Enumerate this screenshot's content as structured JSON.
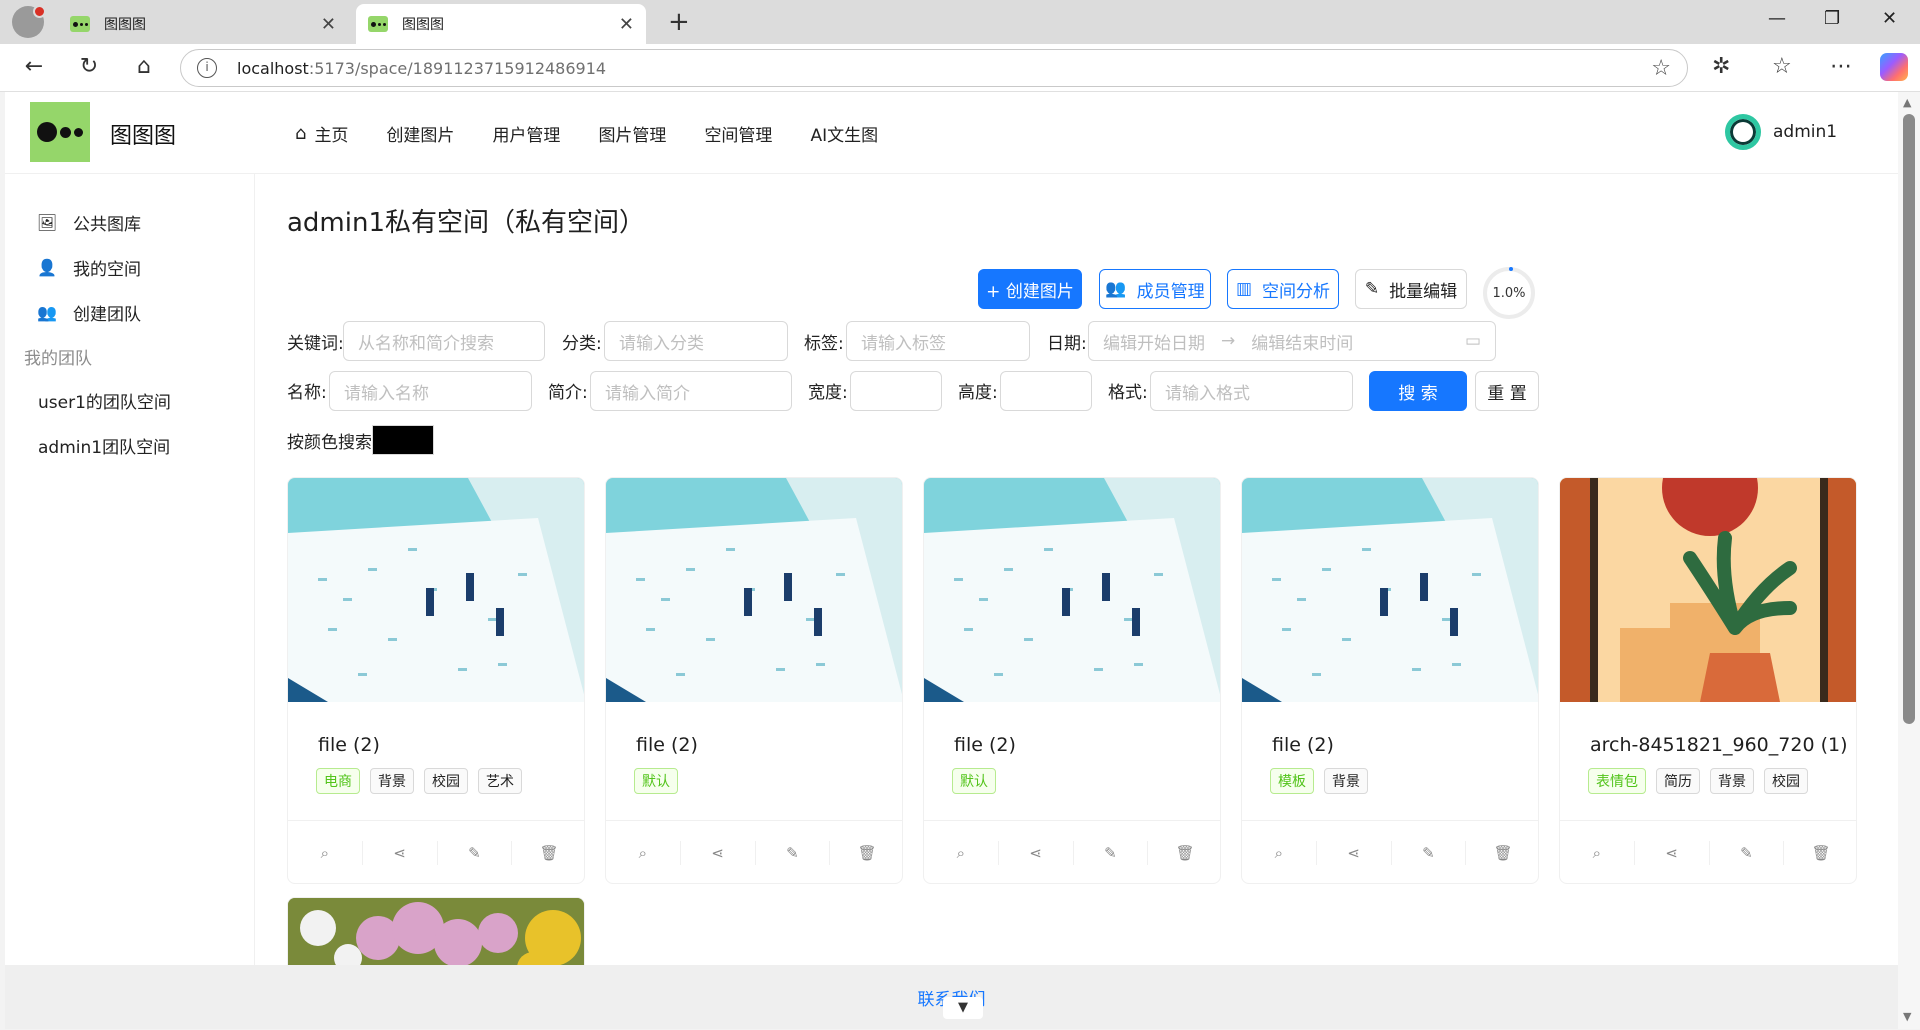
{
  "browser": {
    "tabs": [
      {
        "label": "图图图",
        "active": false
      },
      {
        "label": "图图图",
        "active": true
      }
    ],
    "url_host": "localhost",
    "url_path": ":5173/space/1891123715912486914"
  },
  "header": {
    "site_name": "图图图",
    "menu": [
      "主页",
      "创建图片",
      "用户管理",
      "图片管理",
      "空间管理",
      "AI文生图"
    ],
    "user_name": "admin1"
  },
  "sidebar": {
    "items": [
      "公共图库",
      "我的空间",
      "创建团队"
    ],
    "group_title": "我的团队",
    "teams": [
      "user1的团队空间",
      "admin1团队空间"
    ]
  },
  "space": {
    "title": "admin1私有空间（私有空间）",
    "buttons": {
      "create": "+ 创建图片",
      "members": "成员管理",
      "analyze": "空间分析",
      "batch_edit": "批量编辑"
    },
    "usage_percent": "1.0%"
  },
  "filters": {
    "keyword_label": "关键词:",
    "keyword_placeholder": "从名称和简介搜索",
    "category_label": "分类:",
    "category_placeholder": "请输入分类",
    "tags_label": "标签:",
    "tags_placeholder": "请输入标签",
    "date_label": "日期:",
    "date_start_placeholder": "编辑开始日期",
    "date_end_placeholder": "编辑结束时间",
    "name_label": "名称:",
    "name_placeholder": "请输入名称",
    "intro_label": "简介:",
    "intro_placeholder": "请输入简介",
    "width_label": "宽度:",
    "height_label": "高度:",
    "format_label": "格式:",
    "format_placeholder": "请输入格式",
    "search_button": "搜 索",
    "reset_button": "重 置",
    "color_label": "按颜色搜索:",
    "color_value": "#000000"
  },
  "pictures": [
    {
      "name": "file (2)",
      "tags": [
        {
          "text": "电商",
          "green": true
        },
        {
          "text": "背景"
        },
        {
          "text": "校园"
        },
        {
          "text": "艺术"
        }
      ]
    },
    {
      "name": "file (2)",
      "tags": [
        {
          "text": "默认",
          "green": true
        }
      ]
    },
    {
      "name": "file (2)",
      "tags": [
        {
          "text": "默认",
          "green": true
        }
      ]
    },
    {
      "name": "file (2)",
      "tags": [
        {
          "text": "模板",
          "green": true
        },
        {
          "text": "背景"
        }
      ]
    },
    {
      "name": "arch-8451821_960_720 (1)",
      "tags": [
        {
          "text": "表情包",
          "green": true
        },
        {
          "text": "简历"
        },
        {
          "text": "背景"
        },
        {
          "text": "校园"
        }
      ]
    }
  ],
  "footer": {
    "link": "联系我们"
  }
}
